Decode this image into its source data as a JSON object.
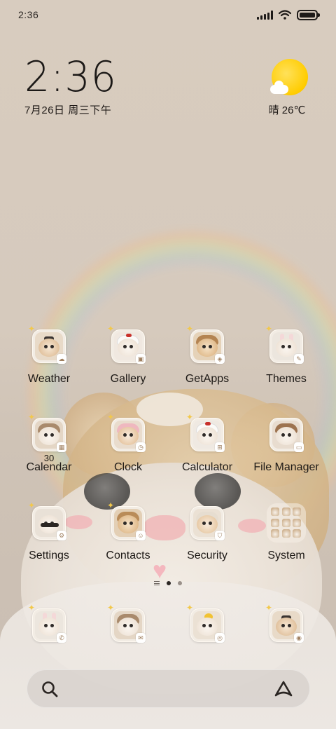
{
  "status_bar": {
    "time": "2:36"
  },
  "clock_widget": {
    "time": "2:36",
    "date": "7月26日 周三下午"
  },
  "weather_widget": {
    "condition_icon": "sun-cloud-icon",
    "text": "晴 26℃"
  },
  "apps": {
    "row1": [
      {
        "label": "Weather",
        "badge_icon": "cloud-badge-icon"
      },
      {
        "label": "Gallery",
        "badge_icon": "photo-badge-icon"
      },
      {
        "label": "GetApps",
        "badge_icon": "bag-badge-icon"
      },
      {
        "label": "Themes",
        "badge_icon": "brush-badge-icon"
      }
    ],
    "row2": [
      {
        "label": "Calendar",
        "badge_icon": "calendar-badge-icon",
        "day": "30"
      },
      {
        "label": "Clock",
        "badge_icon": "clock-badge-icon"
      },
      {
        "label": "Calculator",
        "badge_icon": "calculator-badge-icon"
      },
      {
        "label": "File Manager",
        "badge_icon": "folder-badge-icon"
      }
    ],
    "row3": [
      {
        "label": "Settings",
        "badge_icon": "gear-badge-icon"
      },
      {
        "label": "Contacts",
        "badge_icon": "person-badge-icon"
      },
      {
        "label": "Security",
        "badge_icon": "shield-badge-icon"
      },
      {
        "label": "System",
        "badge_icon": "folder-icon"
      }
    ]
  },
  "dock": [
    {
      "name": "phone",
      "badge_icon": "phone-badge-icon"
    },
    {
      "name": "messages",
      "badge_icon": "message-badge-icon"
    },
    {
      "name": "browser",
      "badge_icon": "browser-badge-icon"
    },
    {
      "name": "camera",
      "badge_icon": "camera-badge-icon"
    }
  ],
  "page_indicator": {
    "pages": 2,
    "active": 1
  },
  "search_bar": {
    "search_icon": "search-icon",
    "assistant_icon": "triangle-logo-icon"
  },
  "colors": {
    "wallpaper": "#d8ccbf",
    "sun": "#ffcc00",
    "text": "#1d1916"
  }
}
